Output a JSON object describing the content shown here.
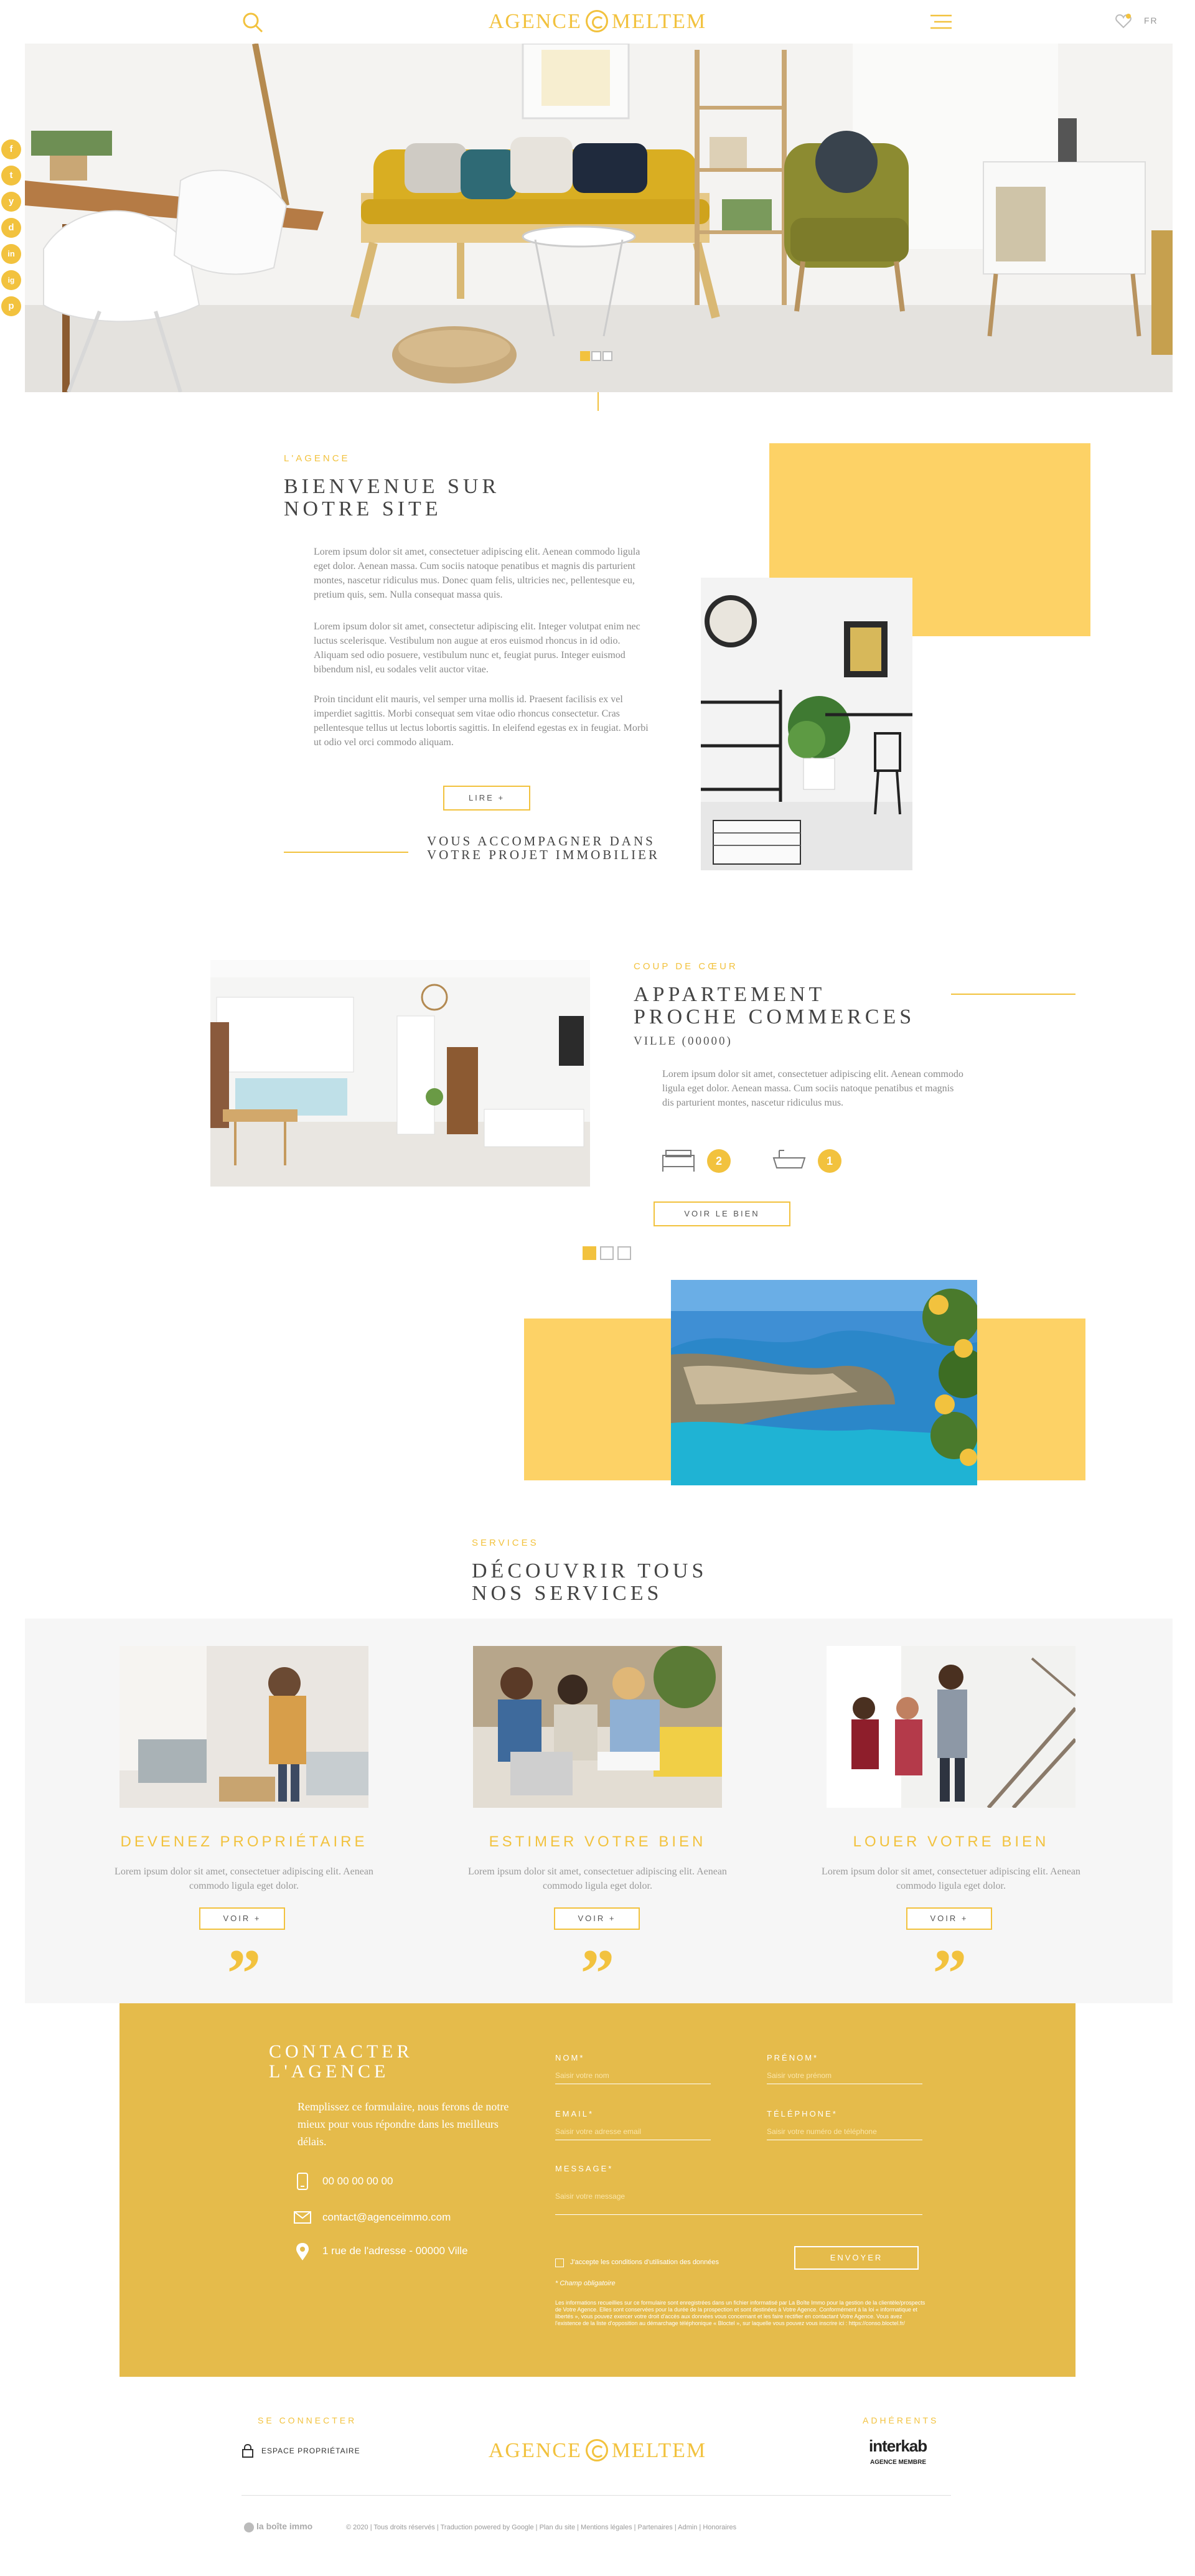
{
  "header": {
    "brand_left": "AGENCE",
    "brand_right": "MELTEM",
    "lang": "FR"
  },
  "social": [
    "f",
    "t",
    "y",
    "d",
    "in",
    "ig",
    "p"
  ],
  "hero": {
    "slides": 3,
    "active": 1
  },
  "about": {
    "kicker": "L'AGENCE",
    "title_line1": "BIENVENUE SUR",
    "title_line2": "NOTRE SITE",
    "p1": "Lorem ipsum dolor sit amet, consectetuer adipiscing elit. Aenean commodo ligula eget dolor. Aenean massa. Cum sociis natoque penatibus et magnis dis parturient montes, nascetur ridiculus mus. Donec quam felis, ultricies nec, pellentesque eu, pretium quis, sem. Nulla consequat massa quis.",
    "p2": "Lorem ipsum dolor sit amet, consectetur adipiscing elit. Integer volutpat enim nec luctus scelerisque. Vestibulum non augue at eros euismod rhoncus in id odio. Aliquam sed odio posuere, vestibulum nunc et, feugiat purus. Integer euismod bibendum nisl, eu sodales velit auctor vitae.",
    "p3": "Proin tincidunt elit mauris, vel semper urna mollis id. Praesent facilisis ex vel imperdiet sagittis. Morbi consequat sem vitae odio rhoncus consectetur. Cras pellentesque tellus ut lectus lobortis sagittis. In eleifend egestas ex in feugiat. Morbi ut odio vel orci commodo aliquam.",
    "button": "LIRE +",
    "tagline_line1": "VOUS ACCOMPAGNER DANS",
    "tagline_line2": "VOTRE PROJET IMMOBILIER"
  },
  "featured": {
    "kicker": "COUP DE  CŒUR",
    "title_line1": "APPARTEMENT",
    "title_line2": "PROCHE COMMERCES",
    "city": "VILLE (00000)",
    "text": "Lorem ipsum dolor sit amet, consectetuer adipiscing elit. Aenean commodo ligula eget dolor. Aenean massa. Cum sociis natoque penatibus et magnis dis parturient montes, nascetur ridiculus mus.",
    "bedrooms": "2",
    "bathrooms": "1",
    "button": "VOIR LE BIEN",
    "slides": 3,
    "active": 1
  },
  "services": {
    "kicker": "SERVICES",
    "title_line1": "DÉCOUVRIR TOUS",
    "title_line2": "NOS SERVICES",
    "items": [
      {
        "title": "DEVENEZ PROPRIÉTAIRE",
        "text": "Lorem ipsum dolor sit amet, consectetuer adipiscing elit. Aenean commodo ligula eget dolor.",
        "button": "VOIR +"
      },
      {
        "title": "ESTIMER VOTRE BIEN",
        "text": "Lorem ipsum dolor sit amet, consectetuer adipiscing elit. Aenean commodo ligula eget dolor.",
        "button": "VOIR +"
      },
      {
        "title": "LOUER VOTRE BIEN",
        "text": "Lorem ipsum dolor sit amet, consectetuer adipiscing elit. Aenean commodo ligula eget dolor.",
        "button": "VOIR +"
      }
    ]
  },
  "contact": {
    "title_line1": "CONTACTER",
    "title_line2": "L'AGENCE",
    "intro": "Remplissez ce formulaire, nous ferons de notre mieux pour vous répondre dans les meilleurs délais.",
    "phone": "00 00 00 00 00",
    "email": "contact@agenceimmo.com",
    "address": "1 rue de l'adresse - 00000 Ville",
    "fields": {
      "nom_label": "NOM*",
      "nom_placeholder": "Saisir votre nom",
      "prenom_label": "PRÉNOM*",
      "prenom_placeholder": "Saisir votre prénom",
      "email_label": "EMAIL*",
      "email_placeholder": "Saisir votre adresse email",
      "tel_label": "TÉLÉPHONE*",
      "tel_placeholder": "Saisir votre numéro de téléphone",
      "message_label": "MESSAGE*",
      "message_placeholder": "Saisir votre message"
    },
    "consent": "J'accepte les conditions d'utilisation des données",
    "required_note": "* Champ obligatoire",
    "submit": "ENVOYER",
    "legal": "Les informations recueillies sur ce formulaire sont enregistrées dans un fichier informatisé par La Boîte Immo pour la gestion de la clientèle/prospects de Votre Agence. Elles sont conservées pour la durée de la prospection et sont destinées à Votre Agence. Conformément à la loi « informatique et libertés », vous pouvez exercer votre droit d'accès aux données vous concernant et les faire rectifier en contactant Votre Agence. Vous avez l'existence de la liste d'opposition au démarchage téléphonique « Bloctel », sur laquelle vous pouvez vous inscrire ici : https://conso.bloctel.fr/"
  },
  "footer": {
    "connect_label": "SE CONNECTER",
    "owner_space": "ESPACE PROPRIÉTAIRE",
    "members_label": "ADHÉRENTS",
    "partner_name": "interkab",
    "partner_sub": "AGENCE MEMBRE",
    "credit_brand": "la boîte immo",
    "legal_line": "© 2020 | Tous droits réservés | Traduction powered by Google | Plan du site | Mentions légales | Partenaires | Admin | Honoraires"
  }
}
